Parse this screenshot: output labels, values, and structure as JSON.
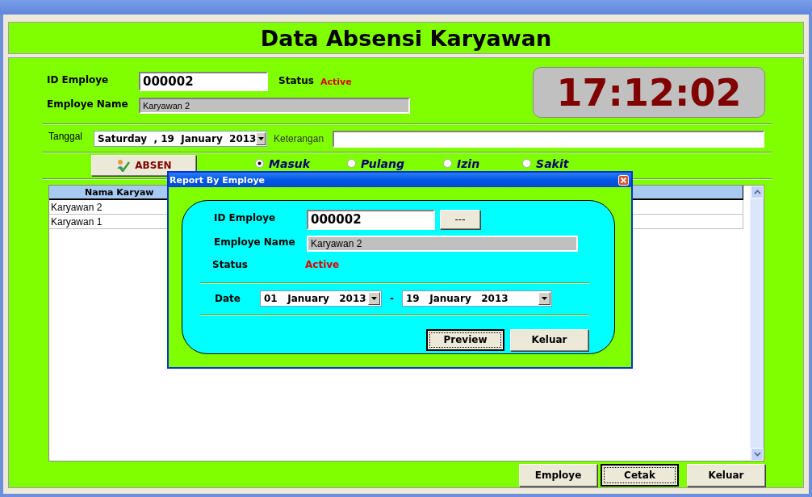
{
  "header": {
    "title": "Data Absensi Karyawan"
  },
  "form": {
    "id_label": "ID Employe",
    "id_value": "000002",
    "status_label": "Status",
    "status_value": "Active",
    "name_label": "Employe Name",
    "name_value": "Karyawan 2",
    "date_label": "Tanggal",
    "date_value": "Saturday  , 19  January  2013",
    "note_label": "Keterangan"
  },
  "clock": "17:12:02",
  "absen_button": "ABSEN",
  "attendance_options": [
    {
      "label": "Masuk",
      "selected": true
    },
    {
      "label": "Pulang",
      "selected": false
    },
    {
      "label": "Izin",
      "selected": false
    },
    {
      "label": "Sakit",
      "selected": false
    }
  ],
  "table": {
    "columns": [
      "Nama Karyaw"
    ],
    "rows": [
      [
        "Karyawan 2"
      ],
      [
        "Karyawan 1"
      ]
    ]
  },
  "buttons": [
    {
      "label": "Employe",
      "focused": false
    },
    {
      "label": "Cetak",
      "focused": true
    },
    {
      "label": "Keluar",
      "focused": false
    }
  ],
  "dialog": {
    "title": "Report By Employe",
    "id_label": "ID Employe",
    "id_value": "000002",
    "browse_button": "---",
    "name_label": "Employe Name",
    "name_value": "Karyawan 2",
    "status_label": "Status",
    "status_value": "Active",
    "date_label": "Date",
    "date_from": "01   January   2013",
    "separator": "-",
    "date_to": "19   January   2013",
    "buttons": [
      {
        "label": "Preview",
        "focused": true
      },
      {
        "label": "Keluar",
        "focused": false
      }
    ]
  }
}
